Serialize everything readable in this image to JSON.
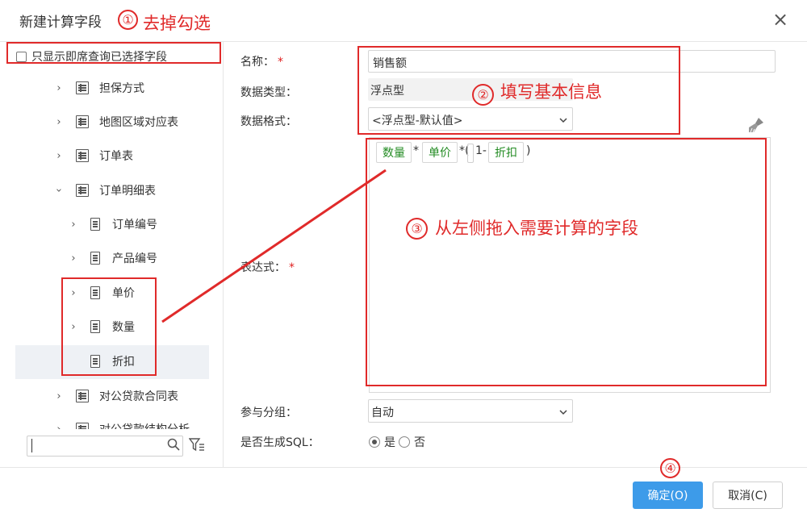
{
  "dialog": {
    "title": "新建计算字段",
    "close_glyph": "×"
  },
  "tree": {
    "only_selected_label": "只显示即席查询已选择字段",
    "items": [
      {
        "label": "担保方式"
      },
      {
        "label": "地图区域对应表"
      },
      {
        "label": "订单表"
      },
      {
        "label": "订单明细表"
      },
      {
        "label": "订单编号"
      },
      {
        "label": "产品编号"
      },
      {
        "label": "单价"
      },
      {
        "label": "数量"
      },
      {
        "label": "折扣"
      },
      {
        "label": "对公贷款合同表"
      },
      {
        "label": "对公贷款结构分析"
      }
    ],
    "search_value": ""
  },
  "form": {
    "name_label": "名称：",
    "name_value": "销售额",
    "type_label": "数据类型：",
    "type_value": "浮点型",
    "format_label": "数据格式：",
    "format_value": "<浮点型-默认值>",
    "expr_label": "表达式：",
    "required_mark": "*",
    "group_label": "参与分组：",
    "group_value": "自动",
    "sql_label": "是否生成SQL：",
    "sql_yes": "是",
    "sql_no": "否"
  },
  "expression": {
    "chip1": "数量",
    "op1": "*",
    "chip2": "单价",
    "op2": "*(",
    "num": "1-",
    "chip3": "折扣",
    "close": ")"
  },
  "buttons": {
    "ok": "确定(O)",
    "cancel": "取消(C)"
  },
  "annotations": {
    "step1": "去掉勾选",
    "step1_num": "①",
    "step2": "填写基本信息",
    "step2_num": "②",
    "step3": "从左侧拖入需要计算的字段",
    "step3_num": "③",
    "step4_num": "④"
  },
  "colors": {
    "accent": "#3d9be9",
    "annotation": "#e02a2a",
    "chip_text": "#228b22"
  }
}
